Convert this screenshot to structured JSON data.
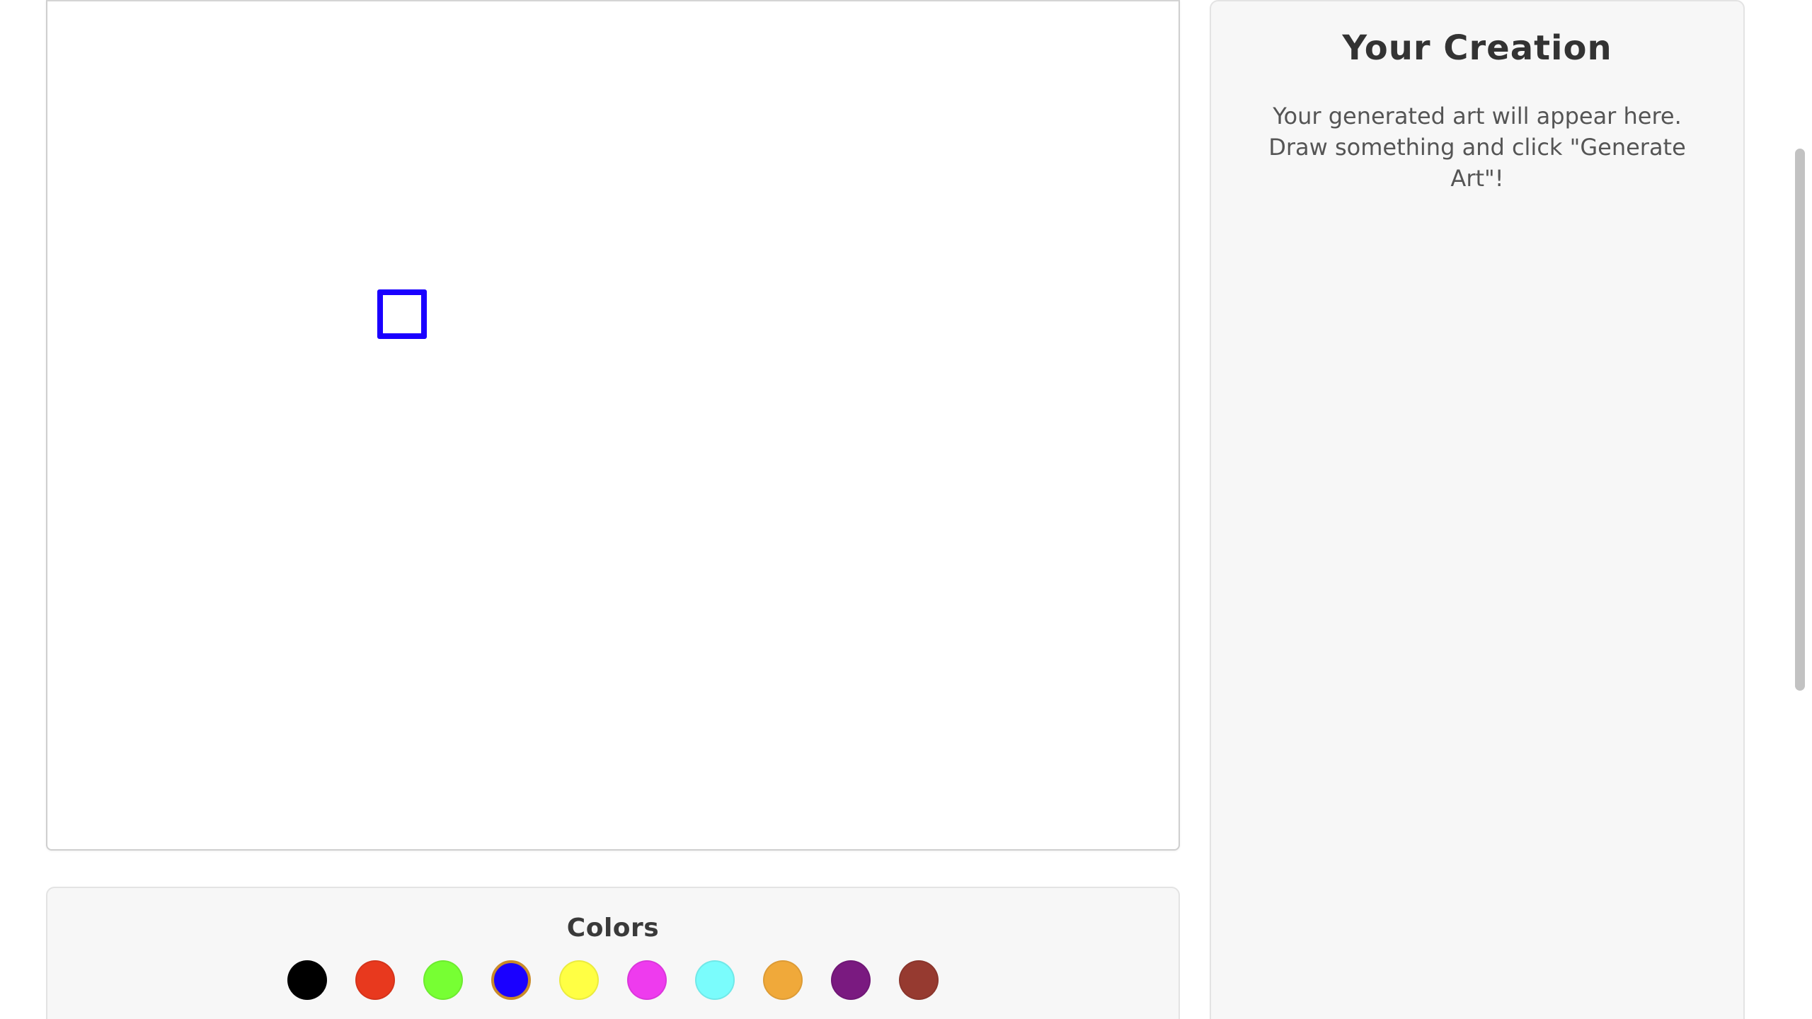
{
  "canvas": {
    "stroke_color": "#1a00ff",
    "shape": "square-outline"
  },
  "colors_panel": {
    "title": "Colors",
    "swatches": [
      {
        "name": "black",
        "color": "#000000",
        "selected": false
      },
      {
        "name": "red",
        "color": "#e8391e",
        "selected": false
      },
      {
        "name": "green",
        "color": "#77ff33",
        "selected": false
      },
      {
        "name": "blue",
        "color": "#1a00ff",
        "selected": true
      },
      {
        "name": "yellow",
        "color": "#ffff44",
        "selected": false
      },
      {
        "name": "magenta",
        "color": "#ee3bee",
        "selected": false
      },
      {
        "name": "cyan",
        "color": "#7afcfc",
        "selected": false
      },
      {
        "name": "orange",
        "color": "#f0a93a",
        "selected": false
      },
      {
        "name": "purple",
        "color": "#7a1a80",
        "selected": false
      },
      {
        "name": "brown",
        "color": "#963a30",
        "selected": false
      }
    ]
  },
  "creation_panel": {
    "title": "Your Creation",
    "placeholder": "Your generated art will appear here. Draw something and click \"Generate Art\"!"
  }
}
